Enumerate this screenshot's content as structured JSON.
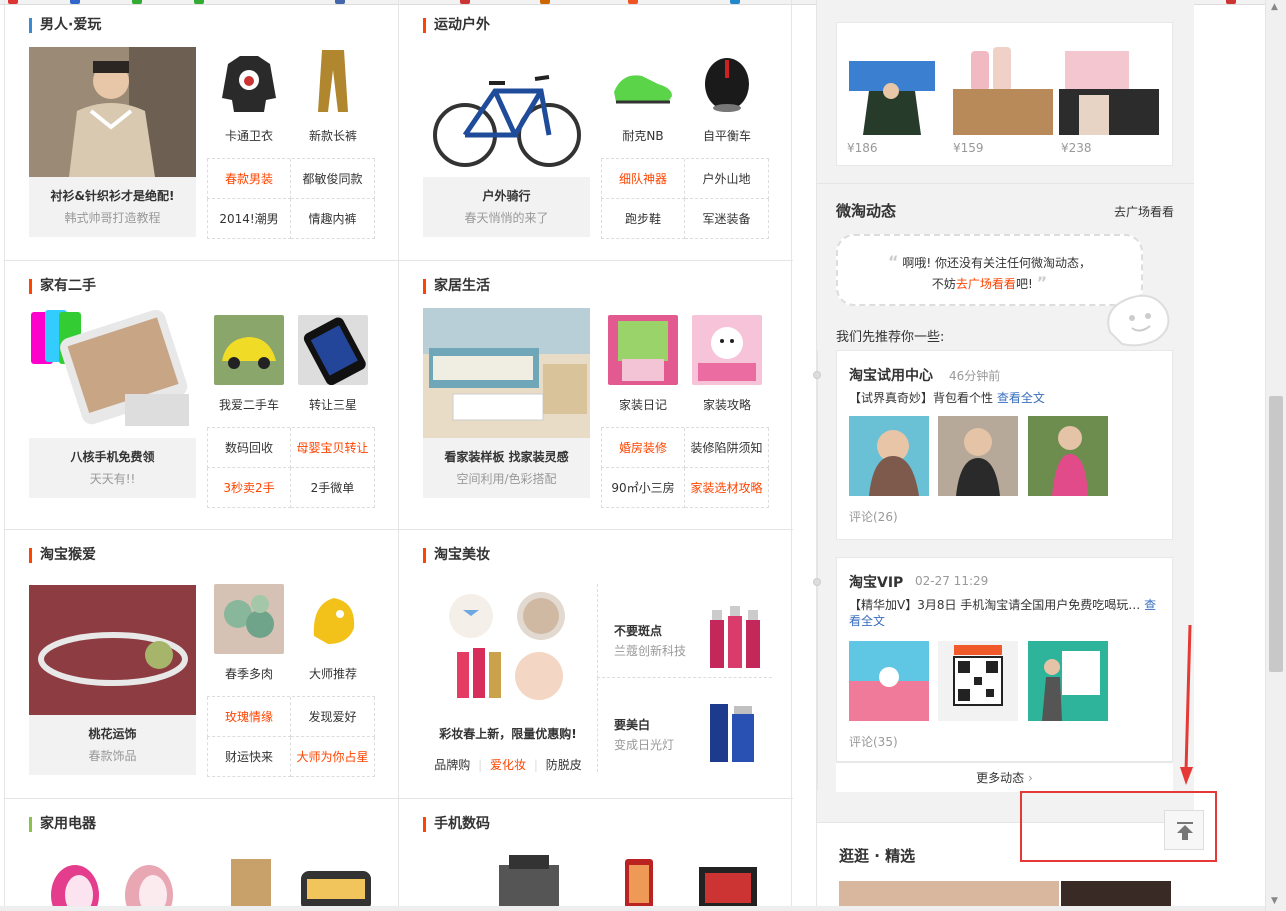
{
  "left": {
    "cells": [
      {
        "title": "男人·爱玩",
        "hero": {
          "t1": "衬衫&针织衫才是绝配!",
          "t2": "韩式帅哥打造教程"
        },
        "minis": [
          {
            "label": "卡通卫衣"
          },
          {
            "label": "新款长裤"
          }
        ],
        "grid": [
          {
            "text": "春款男装",
            "orange": true
          },
          {
            "text": "都敏俊同款",
            "orange": false
          },
          {
            "text": "2014!潮男",
            "orange": false
          },
          {
            "text": "情趣内裤",
            "orange": false
          }
        ]
      },
      {
        "title": "运动户外",
        "hero": {
          "t1": "户外骑行",
          "t2": "春天悄悄的来了"
        },
        "minis": [
          {
            "label": "耐克NB"
          },
          {
            "label": "自平衡车"
          }
        ],
        "grid": [
          {
            "text": "细队神器",
            "orange": true
          },
          {
            "text": "户外山地",
            "orange": false
          },
          {
            "text": "跑步鞋",
            "orange": false
          },
          {
            "text": "军迷装备",
            "orange": false
          }
        ]
      },
      {
        "title": "家有二手",
        "hero": {
          "t1": "八核手机免费领",
          "t2": "天天有!!"
        },
        "minis": [
          {
            "label": "我爱二手车"
          },
          {
            "label": "转让三星"
          }
        ],
        "grid": [
          {
            "text": "数码回收",
            "orange": false
          },
          {
            "text": "母婴宝贝转让",
            "orange": true
          },
          {
            "text": "3秒卖2手",
            "orange": true
          },
          {
            "text": "2手微单",
            "orange": false
          }
        ]
      },
      {
        "title": "家居生活",
        "hero": {
          "t1": "看家装样板 找家装灵感",
          "t2": "空间利用/色彩搭配"
        },
        "minis": [
          {
            "label": "家装日记"
          },
          {
            "label": "家装攻略"
          }
        ],
        "grid": [
          {
            "text": "婚房装修",
            "orange": true
          },
          {
            "text": "装修陷阱须知",
            "orange": false
          },
          {
            "text": "90㎡小三房",
            "orange": false
          },
          {
            "text": "家装选材攻略",
            "orange": true
          }
        ]
      },
      {
        "title": "淘宝猴爱",
        "hero": {
          "t1": "桃花运饰",
          "t2": "春款饰品"
        },
        "minis": [
          {
            "label": "春季多肉"
          },
          {
            "label": "大师推荐"
          }
        ],
        "grid": [
          {
            "text": "玫瑰情缘",
            "orange": true
          },
          {
            "text": "发现爱好",
            "orange": false
          },
          {
            "text": "财运快来",
            "orange": false
          },
          {
            "text": "大师为你占星",
            "orange": true
          }
        ]
      },
      {
        "title": "淘宝美妆",
        "big": {
          "caption": "彩妆春上新，限量优惠购!",
          "links": [
            "品牌购",
            "爱化妆",
            "防脱皮"
          ]
        },
        "side": [
          {
            "h": "不要斑点",
            "s": "兰蔻创新科技"
          },
          {
            "h": "要美白",
            "s": "变成日光灯"
          }
        ]
      },
      {
        "title": "家用电器"
      },
      {
        "title": "手机数码"
      }
    ]
  },
  "sidebar": {
    "top_prices": [
      "¥186",
      "¥159",
      "¥238"
    ],
    "weitao": {
      "title": "微淘动态",
      "link": "去广场看看",
      "bubble_line1": "啊哦! 你还没有关注任何微淘动态，",
      "bubble_line2_pre": "不妨",
      "bubble_line2_link": "去广场看看",
      "bubble_line2_post": "吧!",
      "recommend": "我们先推荐你一些:"
    },
    "feeds": [
      {
        "name": "淘宝试用中心",
        "time": "46分钟前",
        "desc": "【试界真奇妙】背包看个性",
        "desc_link": "查看全文",
        "comments": "评论(26)"
      },
      {
        "name": "淘宝VIP",
        "time": "02-27 11:29",
        "desc": "【精华加V】3月8日 手机淘宝请全国用户免费吃喝玩…",
        "desc_link": "查看全文",
        "comments": "评论(35)"
      }
    ],
    "more": "更多动态",
    "guang_title": "逛逛 · 精选"
  },
  "colors": {
    "accent": "#ff4400",
    "link_blue": "#3a6fc0",
    "annotation_red": "#e53935"
  }
}
